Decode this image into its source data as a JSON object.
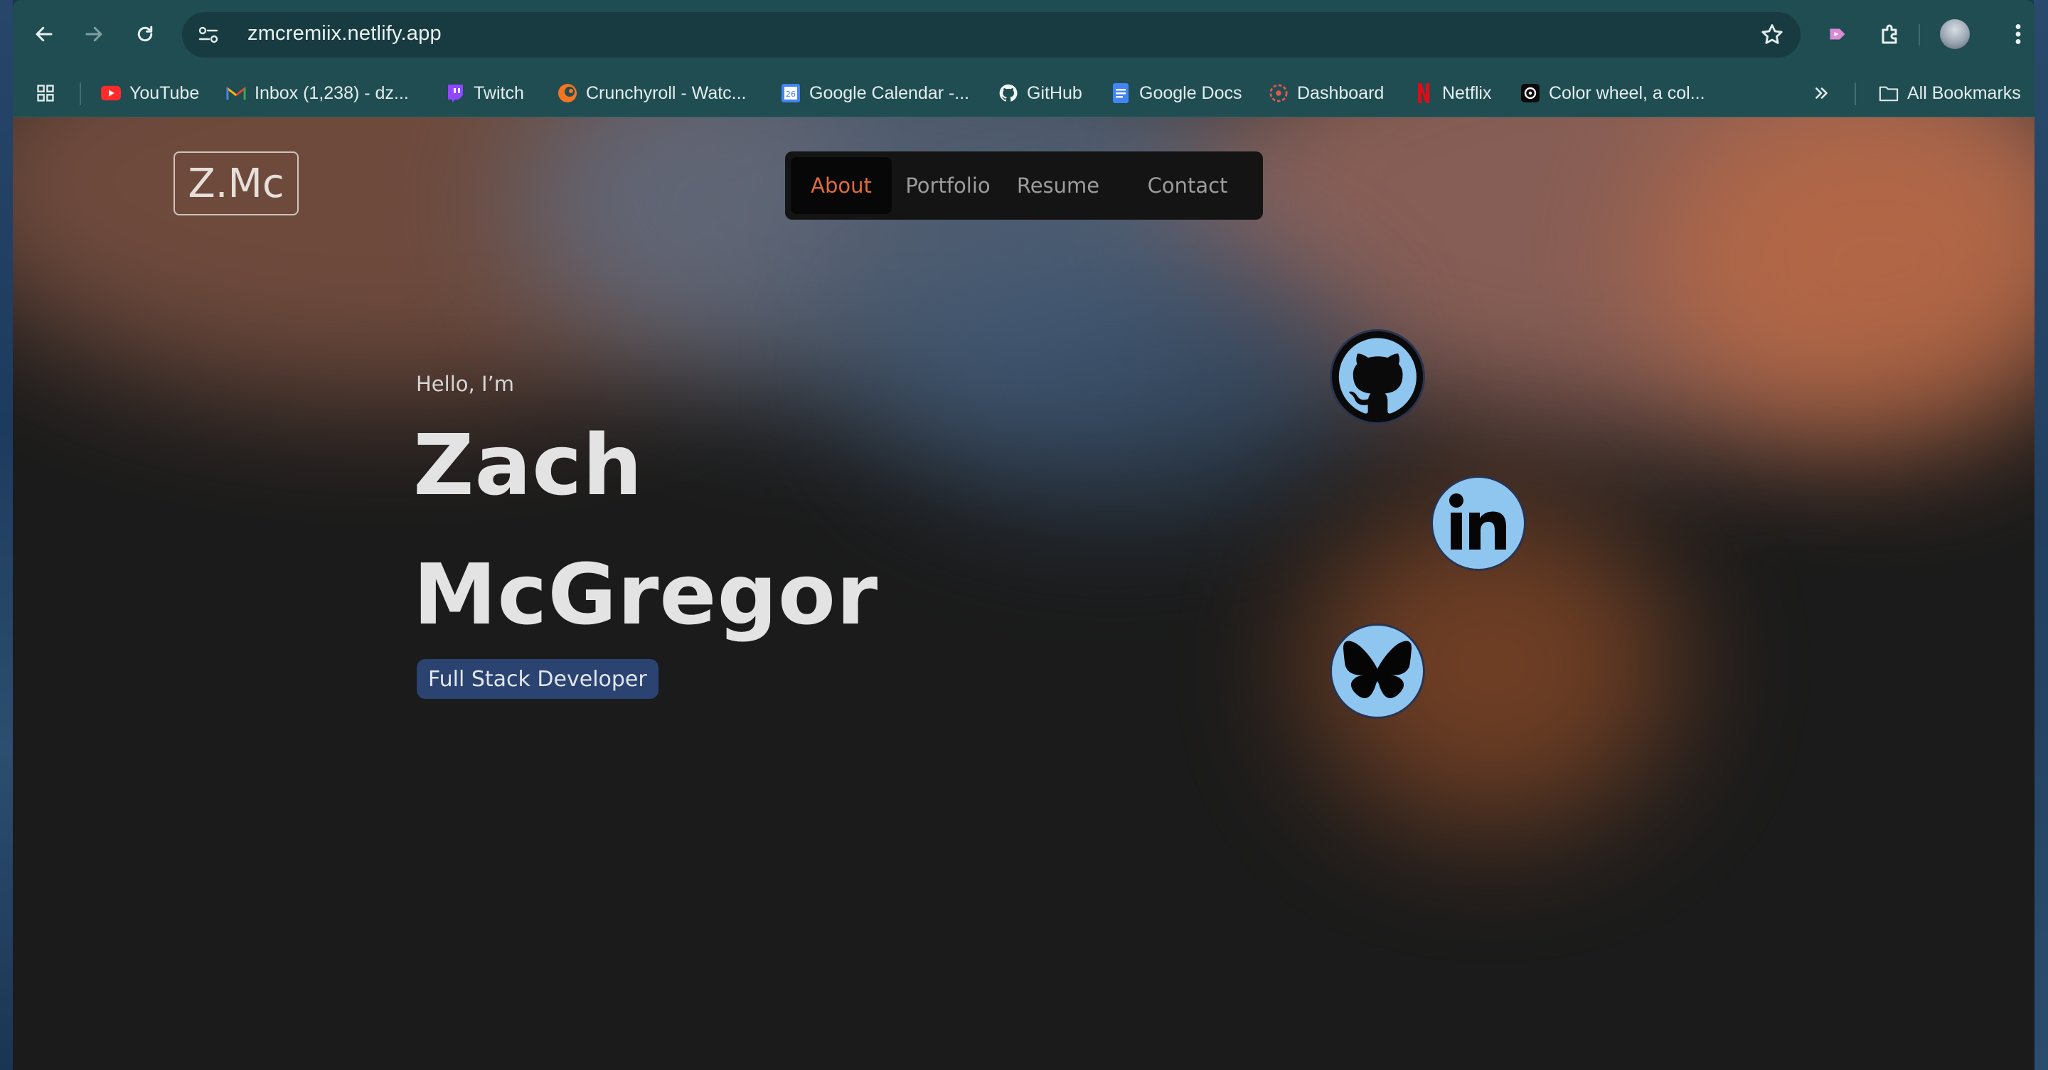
{
  "browser": {
    "url": "zmcremiix.netlify.app"
  },
  "bookmarks": {
    "items": [
      {
        "label": "YouTube",
        "icon": "youtube-icon"
      },
      {
        "label": "Inbox (1,238) - dz...",
        "icon": "gmail-icon"
      },
      {
        "label": "Twitch",
        "icon": "twitch-icon"
      },
      {
        "label": "Crunchyroll - Watc...",
        "icon": "crunchyroll-icon"
      },
      {
        "label": "Google Calendar -...",
        "icon": "google-calendar-icon"
      },
      {
        "label": "GitHub",
        "icon": "github-icon"
      },
      {
        "label": "Google Docs",
        "icon": "google-docs-icon"
      },
      {
        "label": "Dashboard",
        "icon": "dashboard-icon"
      },
      {
        "label": "Netflix",
        "icon": "netflix-icon"
      },
      {
        "label": "Color wheel, a col...",
        "icon": "color-wheel-icon"
      }
    ],
    "all_bookmarks": "All Bookmarks"
  },
  "site": {
    "logo": "Z.Mc",
    "nav": [
      {
        "label": "About",
        "active": true
      },
      {
        "label": "Portfolio",
        "active": false
      },
      {
        "label": "Resume",
        "active": false
      },
      {
        "label": "Contact",
        "active": false
      }
    ],
    "hero": {
      "greeting": "Hello, I’m",
      "first_name": "Zach",
      "last_name": "McGregor",
      "role": "Full Stack Developer"
    },
    "socials": [
      {
        "name": "GitHub",
        "icon": "github-icon"
      },
      {
        "name": "LinkedIn",
        "icon": "linkedin-icon"
      },
      {
        "name": "Bluesky",
        "icon": "bluesky-butterfly-icon"
      }
    ]
  },
  "colors": {
    "toolbar": "#1f4d52",
    "accent_active": "#e06a3e",
    "social_bg": "#8ec6f0",
    "role_badge": "#2a4370"
  }
}
